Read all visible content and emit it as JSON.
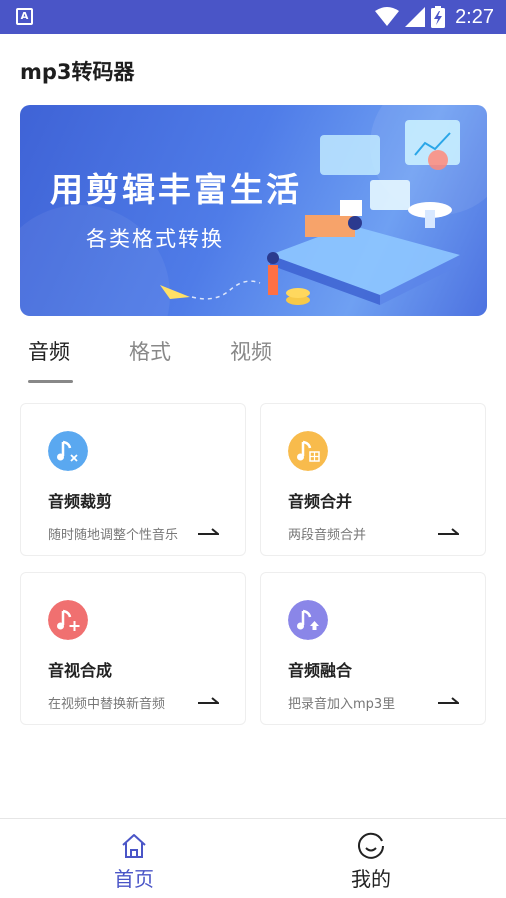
{
  "status_bar": {
    "time": "2:27",
    "notification_icon": "A"
  },
  "app": {
    "title": "mp3转码器"
  },
  "banner": {
    "headline": "用剪辑丰富生活",
    "subline": "各类格式转换"
  },
  "tabs": [
    {
      "label": "音频"
    },
    {
      "label": "格式"
    },
    {
      "label": "视频"
    }
  ],
  "cards": [
    {
      "title": "音频裁剪",
      "desc": "随时随地调整个性音乐",
      "icon": "audio-cut-icon",
      "color": "#5aa8f0"
    },
    {
      "title": "音频合并",
      "desc": "两段音频合并",
      "icon": "audio-merge-icon",
      "color": "#f8bb4c"
    },
    {
      "title": "音视合成",
      "desc": "在视频中替换新音频",
      "icon": "audio-video-compose-icon",
      "color": "#f07070"
    },
    {
      "title": "音频融合",
      "desc": "把录音加入mp3里",
      "icon": "audio-blend-icon",
      "color": "#8a86e8"
    }
  ],
  "bottom_nav": {
    "home_label": "首页",
    "mine_label": "我的"
  },
  "colors": {
    "accent": "#4a55c7",
    "status_bar": "#4a55c7"
  }
}
